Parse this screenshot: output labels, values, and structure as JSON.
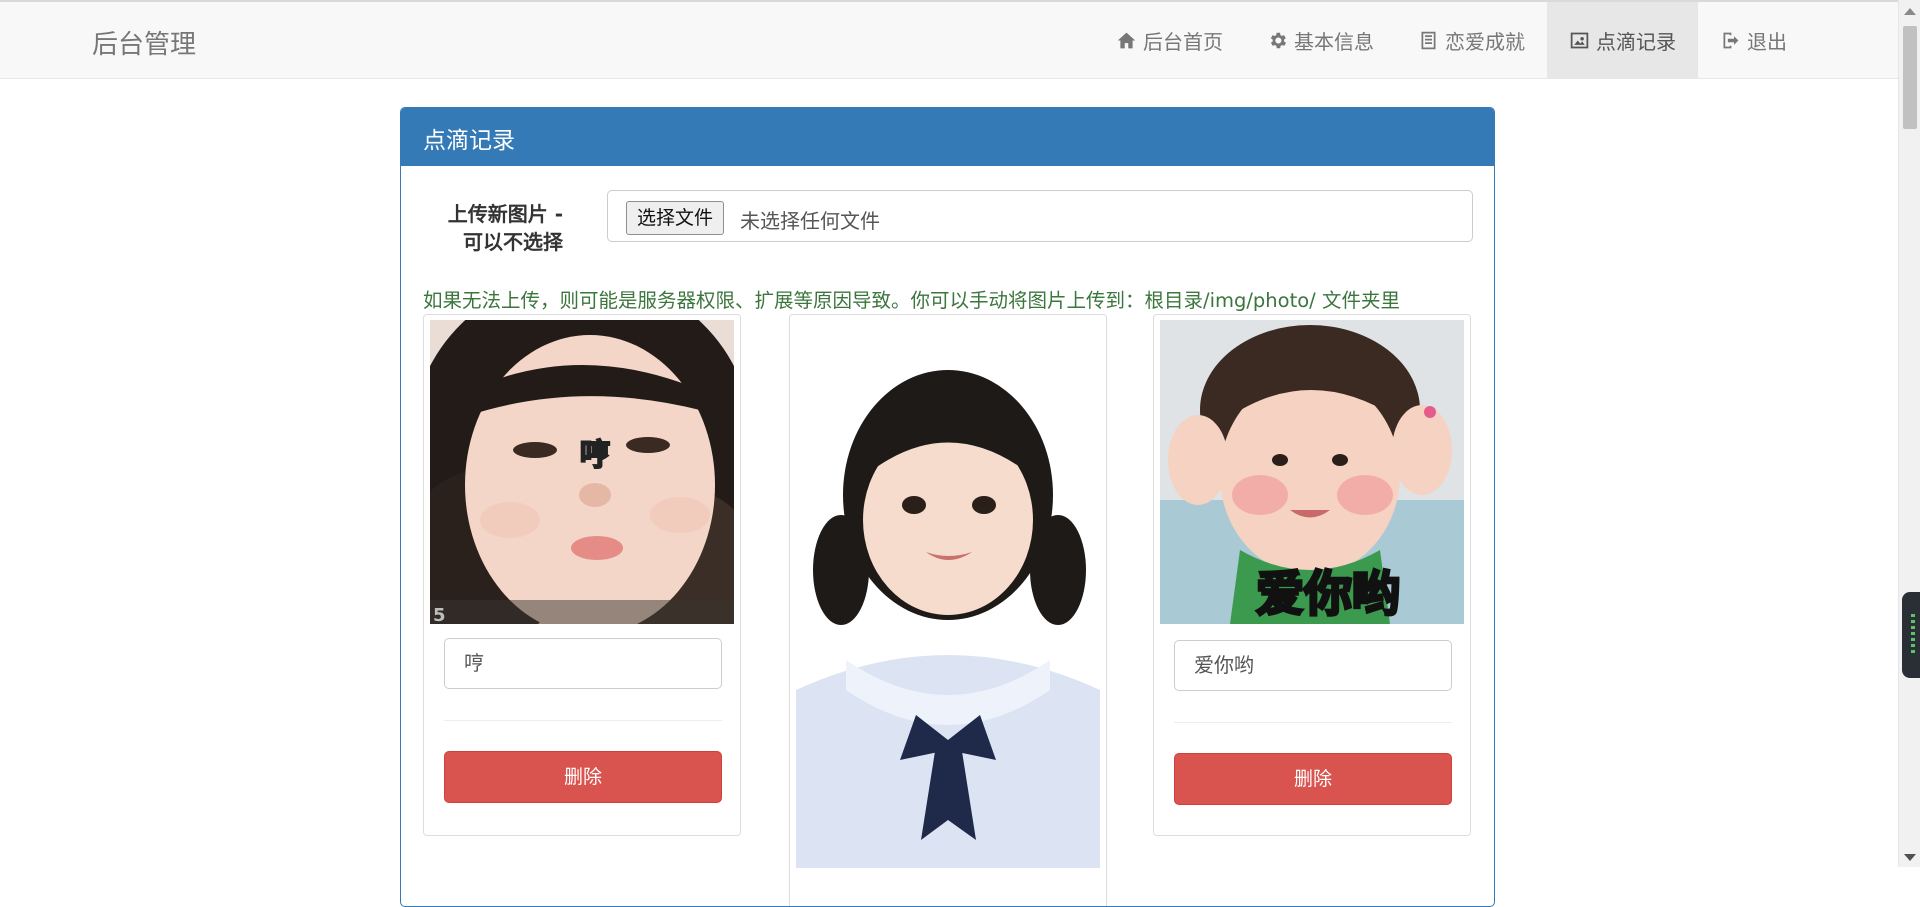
{
  "navbar": {
    "brand": "后台管理",
    "items": [
      {
        "label": "后台首页",
        "icon": "home-icon"
      },
      {
        "label": "基本信息",
        "icon": "gear-icon"
      },
      {
        "label": "恋爱成就",
        "icon": "list-icon"
      },
      {
        "label": "点滴记录",
        "icon": "picture-icon",
        "active": true
      },
      {
        "label": "退出",
        "icon": "logout-icon"
      }
    ]
  },
  "panel": {
    "title": "点滴记录",
    "upload_label_line1": "上传新图片 -",
    "upload_label_line2": "可以不选择",
    "file_button": "选择文件",
    "file_status": "未选择任何文件",
    "help_text": "如果无法上传，则可能是服务器权限、扩展等原因导致。你可以手动将图片上传到：根目录/img/photo/ 文件夹里"
  },
  "photos": [
    {
      "overlay_text": "哼",
      "corner_mark": "5",
      "caption": "哼",
      "delete_label": "删除"
    },
    {
      "overlay_text": "",
      "caption": "",
      "delete_label": ""
    },
    {
      "overlay_text": "爱你哟",
      "caption": "爱你哟",
      "delete_label": "删除"
    }
  ],
  "colors": {
    "primary": "#337ab7",
    "danger": "#d9534f",
    "help_text": "#3c763d",
    "navbar_bg": "#f8f8f8"
  }
}
